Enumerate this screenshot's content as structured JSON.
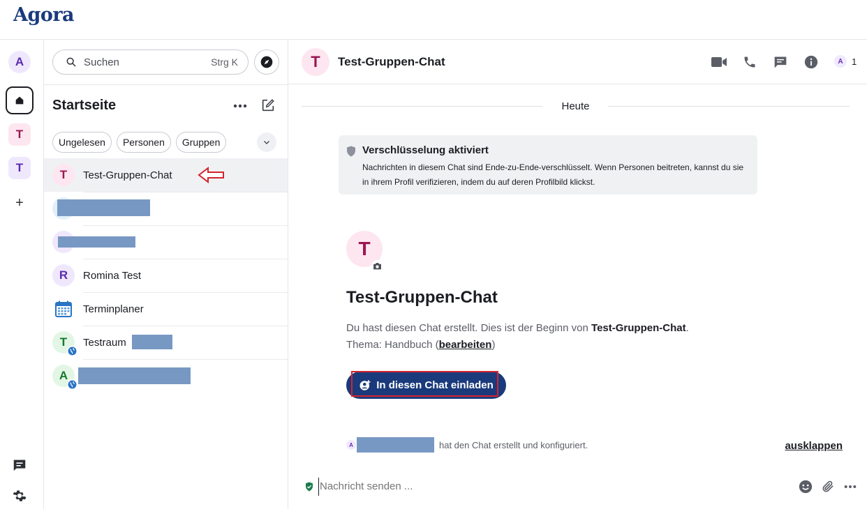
{
  "app": {
    "brand": "Agora"
  },
  "rail": {
    "user_initial": "A",
    "spaces": [
      {
        "initial": "T",
        "color": "#9a1653",
        "bg": "#fde6ef"
      },
      {
        "initial": "T",
        "color": "#5b2bb0",
        "bg": "#efe8fd"
      }
    ],
    "add": "+"
  },
  "roomlist": {
    "search_placeholder": "Suchen",
    "search_shortcut": "Strg K",
    "title": "Startseite",
    "filters": [
      "Ungelesen",
      "Personen",
      "Gruppen"
    ],
    "rooms": [
      {
        "name": "Test-Gruppen-Chat",
        "initial": "T",
        "color": "#9a1653",
        "bg": "#fde6ef"
      },
      {
        "name": "",
        "initial": "",
        "color": "#1a6a9a",
        "bg": "#e2f0fa"
      },
      {
        "name": "",
        "initial": "",
        "color": "#5b2bb0",
        "bg": "#efe8fd"
      },
      {
        "name": "Romina Test",
        "initial": "R",
        "color": "#5b2bb0",
        "bg": "#efe8fd"
      },
      {
        "name": "Terminplaner",
        "initial": "",
        "color": "#2a74c5",
        "bg": "#ffffff"
      },
      {
        "name": "Testraum",
        "initial": "T",
        "color": "#137a2d",
        "bg": "#e3f6e6"
      },
      {
        "name": "",
        "initial": "A",
        "color": "#137a2d",
        "bg": "#e3f6e6"
      }
    ]
  },
  "chat": {
    "title": "Test-Gruppen-Chat",
    "initial": "T",
    "member_initial": "A",
    "member_count": "1",
    "date_separator": "Heute",
    "e2e": {
      "title": "Verschlüsselung aktiviert",
      "body": "Nachrichten in diesem Chat sind Ende-zu-Ende-verschlüsselt. Wenn Personen beitreten, kannst du sie in ihrem Profil verifizieren, indem du auf deren Profilbild klickst."
    },
    "intro": {
      "title": "Test-Gruppen-Chat",
      "line1_prefix": "Du hast diesen Chat erstellt. Dies ist der Beginn von ",
      "line1_room": "Test-Gruppen-Chat",
      "line1_suffix": ".",
      "topic_prefix": "Thema: Handbuch (",
      "topic_link": "bearbeiten",
      "topic_suffix": ")",
      "invite_label": "In diesen Chat einladen"
    },
    "event_text": "hat den Chat erstellt und konfiguriert.",
    "expand_label": "ausklappen",
    "composer_placeholder": "Nachricht senden ..."
  }
}
